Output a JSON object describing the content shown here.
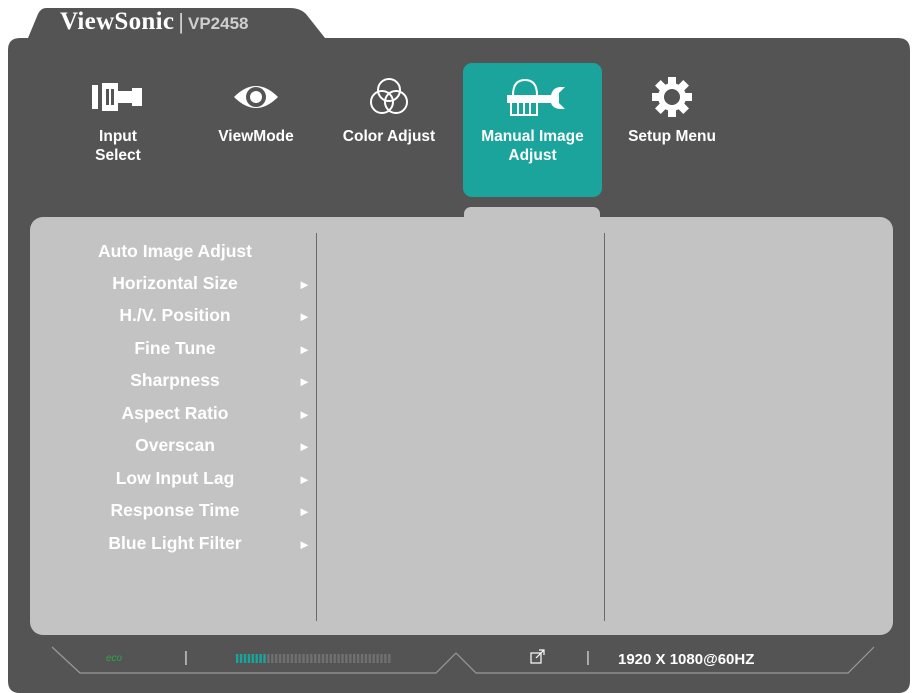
{
  "brand": {
    "name": "ViewSonic",
    "separator": "|",
    "model": "VP2458"
  },
  "tabs": [
    {
      "label": "Input\nSelect",
      "icon": "input-select-icon",
      "active": false
    },
    {
      "label": "ViewMode",
      "icon": "eye-icon",
      "active": false
    },
    {
      "label": "Color Adjust",
      "icon": "color-circles-icon",
      "active": false
    },
    {
      "label": "Manual Image\nAdjust",
      "icon": "hand-wrench-icon",
      "active": true
    },
    {
      "label": "Setup Menu",
      "icon": "gear-icon",
      "active": false
    }
  ],
  "menu": {
    "items": [
      {
        "label": "Auto Image Adjust",
        "has_submenu": false
      },
      {
        "label": "Horizontal Size",
        "has_submenu": true
      },
      {
        "label": "H./V. Position",
        "has_submenu": true
      },
      {
        "label": "Fine Tune",
        "has_submenu": true
      },
      {
        "label": "Sharpness",
        "has_submenu": true
      },
      {
        "label": "Aspect Ratio",
        "has_submenu": true
      },
      {
        "label": "Overscan",
        "has_submenu": true
      },
      {
        "label": "Low Input Lag",
        "has_submenu": true
      },
      {
        "label": "Response Time",
        "has_submenu": true
      },
      {
        "label": "Blue Light Filter",
        "has_submenu": true
      }
    ],
    "arrow_glyph": "►"
  },
  "status_bar": {
    "eco_label": "eco",
    "eco_separator": "|",
    "energy_level": 0.2,
    "energy_segments": 40,
    "input_icon": "input-source-icon",
    "input_separator": "|",
    "resolution": "1920 X 1080@60HZ"
  },
  "colors": {
    "frame": "#545454",
    "active_tab": "#1aa49c",
    "panel": "#c3c3c3",
    "eco_green": "#2aa64a",
    "energy_fill": "#1aa49c"
  }
}
